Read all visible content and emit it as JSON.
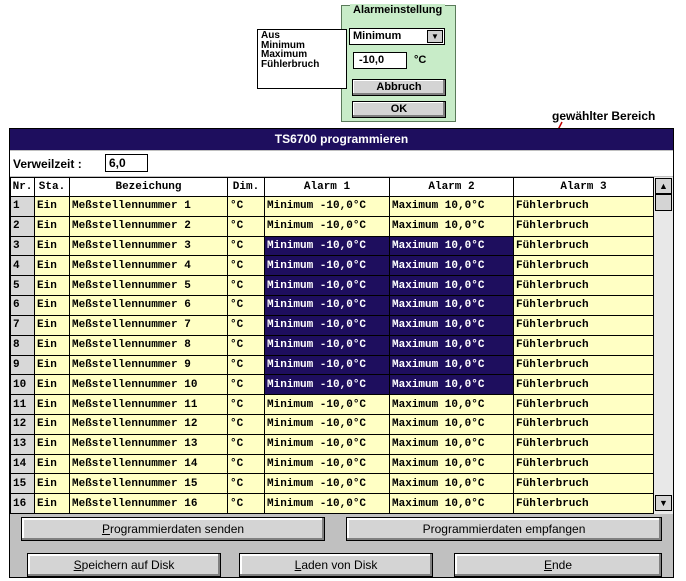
{
  "alarm_dialog": {
    "title": "Alarmeinstellung",
    "list_options": [
      "Aus",
      "Minimum",
      "Maximum",
      "Fühlerbruch"
    ],
    "selected_type": "Minimum",
    "value": "-10,0",
    "unit": "°C",
    "cancel_label": "Abbruch",
    "ok_label": "OK"
  },
  "annotation": "gewählter Bereich",
  "window": {
    "title": "TS6700 programmieren",
    "dwell_label": "Verweilzeit :",
    "dwell_value": "6,0"
  },
  "table": {
    "columns": [
      "Nr.",
      "Sta.",
      "Bezeichung",
      "Dim.",
      "Alarm 1",
      "Alarm 2",
      "Alarm 3"
    ],
    "selected_rows": [
      3,
      10
    ],
    "rows": [
      [
        "1",
        "Ein",
        "Meßstellennummer 1",
        "°C",
        "Minimum -10,0°C",
        "Maximum 10,0°C",
        "Fühlerbruch"
      ],
      [
        "2",
        "Ein",
        "Meßstellennummer 2",
        "°C",
        "Minimum -10,0°C",
        "Maximum 10,0°C",
        "Fühlerbruch"
      ],
      [
        "3",
        "Ein",
        "Meßstellennummer 3",
        "°C",
        "Minimum -10,0°C",
        "Maximum 10,0°C",
        "Fühlerbruch"
      ],
      [
        "4",
        "Ein",
        "Meßstellennummer 4",
        "°C",
        "Minimum -10,0°C",
        "Maximum 10,0°C",
        "Fühlerbruch"
      ],
      [
        "5",
        "Ein",
        "Meßstellennummer 5",
        "°C",
        "Minimum -10,0°C",
        "Maximum 10,0°C",
        "Fühlerbruch"
      ],
      [
        "6",
        "Ein",
        "Meßstellennummer 6",
        "°C",
        "Minimum -10,0°C",
        "Maximum 10,0°C",
        "Fühlerbruch"
      ],
      [
        "7",
        "Ein",
        "Meßstellennummer 7",
        "°C",
        "Minimum -10,0°C",
        "Maximum 10,0°C",
        "Fühlerbruch"
      ],
      [
        "8",
        "Ein",
        "Meßstellennummer 8",
        "°C",
        "Minimum -10,0°C",
        "Maximum 10,0°C",
        "Fühlerbruch"
      ],
      [
        "9",
        "Ein",
        "Meßstellennummer 9",
        "°C",
        "Minimum -10,0°C",
        "Maximum 10,0°C",
        "Fühlerbruch"
      ],
      [
        "10",
        "Ein",
        "Meßstellennummer 10",
        "°C",
        "Minimum -10,0°C",
        "Maximum 10,0°C",
        "Fühlerbruch"
      ],
      [
        "11",
        "Ein",
        "Meßstellennummer 11",
        "°C",
        "Minimum -10,0°C",
        "Maximum 10,0°C",
        "Fühlerbruch"
      ],
      [
        "12",
        "Ein",
        "Meßstellennummer 12",
        "°C",
        "Minimum -10,0°C",
        "Maximum 10,0°C",
        "Fühlerbruch"
      ],
      [
        "13",
        "Ein",
        "Meßstellennummer 13",
        "°C",
        "Minimum -10,0°C",
        "Maximum 10,0°C",
        "Fühlerbruch"
      ],
      [
        "14",
        "Ein",
        "Meßstellennummer 14",
        "°C",
        "Minimum -10,0°C",
        "Maximum 10,0°C",
        "Fühlerbruch"
      ],
      [
        "15",
        "Ein",
        "Meßstellennummer 15",
        "°C",
        "Minimum -10,0°C",
        "Maximum 10,0°C",
        "Fühlerbruch"
      ],
      [
        "16",
        "Ein",
        "Meßstellennummer 16",
        "°C",
        "Minimum -10,0°C",
        "Maximum 10,0°C",
        "Fühlerbruch"
      ]
    ]
  },
  "buttons": {
    "send_underlined": "P",
    "send_rest": "rogrammierdaten senden",
    "receive": "Programmierdaten empfangen",
    "save_underlined": "S",
    "save_rest": "peichern auf Disk",
    "load_underlined": "L",
    "load_rest": "aden von Disk",
    "end_underlined": "E",
    "end_rest": "nde"
  },
  "colors": {
    "title_bar": "#1e0e5e",
    "row_background": "#ffffc4",
    "selection": "#1e0e5e",
    "popup_background": "#c8ecc8"
  },
  "icons": {
    "dropdown": "chevron-down-icon",
    "scroll_up": "arrow-up-icon",
    "scroll_down": "arrow-down-icon"
  }
}
